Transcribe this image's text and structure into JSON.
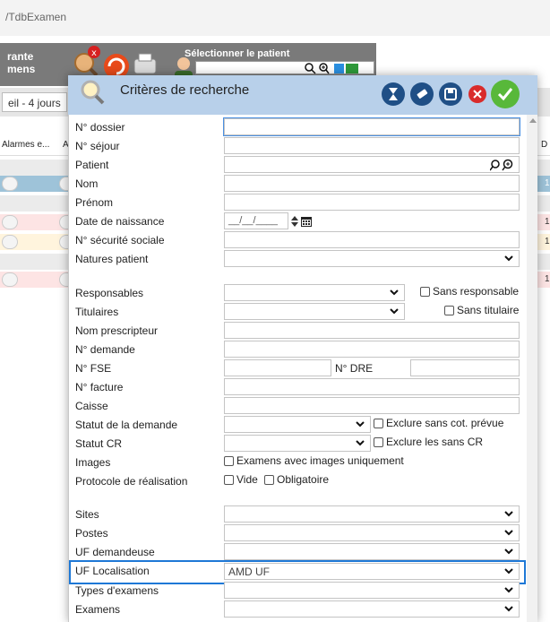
{
  "app": {
    "title": "/TdbExamen"
  },
  "toolbar": {
    "left_line1": "rante",
    "left_line2": "mens",
    "patient_label": "Sélectionner le patient"
  },
  "filter": {
    "label": "eil - 4 jours"
  },
  "grid": {
    "col1": "Alarmes e...",
    "col2": "A",
    "col3": "D",
    "row_nums": [
      "1",
      "1",
      "1",
      "1"
    ]
  },
  "dialog": {
    "title": "Critères de recherche",
    "fields": {
      "dossier": "N° dossier",
      "sejour": "N° séjour",
      "patient": "Patient",
      "nom": "Nom",
      "prenom": "Prénom",
      "date_naissance": "Date de naissance",
      "date_placeholder": "__/__/____",
      "secu": "N° sécurité sociale",
      "natures": "Natures patient",
      "responsables": "Responsables",
      "sans_responsable": "Sans responsable",
      "titulaires": "Titulaires",
      "sans_titulaire": "Sans titulaire",
      "nom_prescripteur": "Nom prescripteur",
      "demande": "N° demande",
      "fse": "N° FSE",
      "dre": "N° DRE",
      "facture": "N° facture",
      "caisse": "Caisse",
      "statut_demande": "Statut de la demande",
      "exclure_cot": "Exclure sans cot. prévue",
      "statut_cr": "Statut CR",
      "exclure_cr": "Exclure les sans CR",
      "images": "Images",
      "images_only": "Examens avec images uniquement",
      "protocole": "Protocole de réalisation",
      "vide": "Vide",
      "obligatoire": "Obligatoire",
      "sites": "Sites",
      "postes": "Postes",
      "uf_demandeuse": "UF demandeuse",
      "uf_localisation": "UF Localisation",
      "uf_localisation_value": "AMD UF",
      "types_examens": "Types d'examens",
      "examens": "Examens"
    }
  },
  "colors": {
    "dialog_header": "#b8d0ea",
    "highlight": "#1e78d6",
    "row_blue": "#9ec3d9",
    "row_pink": "#fde4e4",
    "row_cream": "#fff4dd"
  }
}
